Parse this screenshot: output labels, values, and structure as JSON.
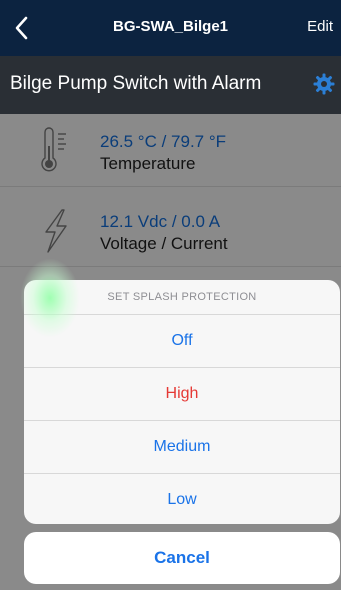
{
  "nav": {
    "back_icon": "chevron-left-icon",
    "title": "BG-SWA_Bilge1",
    "edit_label": "Edit"
  },
  "device": {
    "name": "Bilge Pump Switch with Alarm",
    "settings_icon": "gear-icon"
  },
  "readings": [
    {
      "icon": "thermometer-icon",
      "value": "26.5 °C / 79.7 °F",
      "label": "Temperature"
    },
    {
      "icon": "lightning-icon",
      "value": "12.1 Vdc / 0.0 A",
      "label": "Voltage / Current"
    }
  ],
  "sheet": {
    "title": "SET SPLASH PROTECTION",
    "options": [
      {
        "label": "Off",
        "color": "#1a73e8"
      },
      {
        "label": "High",
        "color": "#e53935"
      },
      {
        "label": "Medium",
        "color": "#1a73e8"
      },
      {
        "label": "Low",
        "color": "#1a73e8"
      }
    ],
    "cancel_label": "Cancel"
  },
  "colors": {
    "accent": "#1a73e8",
    "destructive": "#e53935",
    "navbar": "#0c2340",
    "header": "#2a2f35"
  }
}
